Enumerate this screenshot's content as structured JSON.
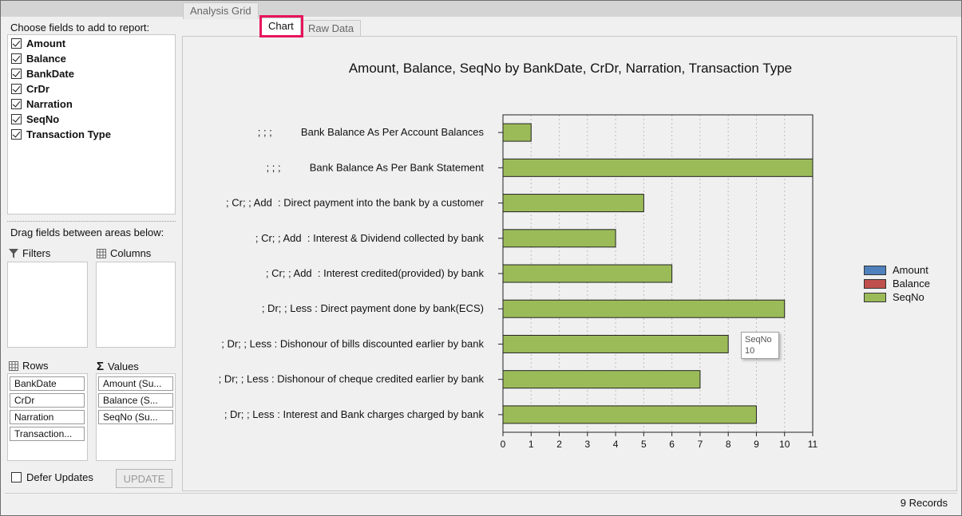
{
  "left_panel": {
    "choose_label": "Choose fields to add to report:",
    "fields": [
      {
        "label": "Amount",
        "checked": true
      },
      {
        "label": "Balance",
        "checked": true
      },
      {
        "label": "BankDate",
        "checked": true
      },
      {
        "label": "CrDr",
        "checked": true
      },
      {
        "label": "Narration",
        "checked": true
      },
      {
        "label": "SeqNo",
        "checked": true
      },
      {
        "label": "Transaction Type",
        "checked": true
      }
    ],
    "drag_label": "Drag fields between areas below:",
    "filters_label": "Filters",
    "columns_label": "Columns",
    "rows_label": "Rows",
    "values_label": "Values",
    "rows": [
      "BankDate",
      "CrDr",
      "Narration",
      "Transaction..."
    ],
    "values": [
      "Amount (Su...",
      "Balance (S...",
      "SeqNo (Su..."
    ],
    "defer_label": "Defer Updates",
    "update_label": "UPDATE"
  },
  "tabs": {
    "analysis": "Analysis Grid",
    "chart": "Chart",
    "raw": "Raw Data"
  },
  "chart_data": {
    "type": "bar",
    "orientation": "horizontal",
    "title": "Amount, Balance, SeqNo by BankDate, CrDr, Narration, Transaction Type",
    "categories": [
      "; ; ;          Bank Balance As Per Account Balances",
      "; ; ;          Bank Balance As Per Bank Statement",
      "; Cr; ; Add  : Direct payment into the bank by a customer",
      "; Cr; ; Add  : Interest & Dividend collected by bank",
      "; Cr; ; Add  : Interest credited(provided) by bank",
      "; Dr; ; Less : Direct payment done by bank(ECS)",
      "; Dr; ; Less : Dishonour of bills discounted earlier by bank",
      "; Dr; ; Less : Dishonour of cheque credited earlier by bank",
      "; Dr; ; Less : Interest and Bank charges charged by bank"
    ],
    "series": [
      {
        "name": "Amount",
        "color": "#4f81bd",
        "values": []
      },
      {
        "name": "Balance",
        "color": "#c0504d",
        "values": []
      },
      {
        "name": "SeqNo",
        "color": "#9bbb59",
        "values": [
          1,
          11,
          5,
          4,
          6,
          10,
          8,
          7,
          9
        ]
      }
    ],
    "xlim": [
      0,
      11
    ],
    "xticks": [
      0,
      1,
      2,
      3,
      4,
      5,
      6,
      7,
      8,
      9,
      10,
      11
    ],
    "grid": "vertical dashed",
    "legend_position": "right"
  },
  "tooltip": {
    "series": "SeqNo",
    "value": "10"
  },
  "status": {
    "records": "9 Records"
  }
}
